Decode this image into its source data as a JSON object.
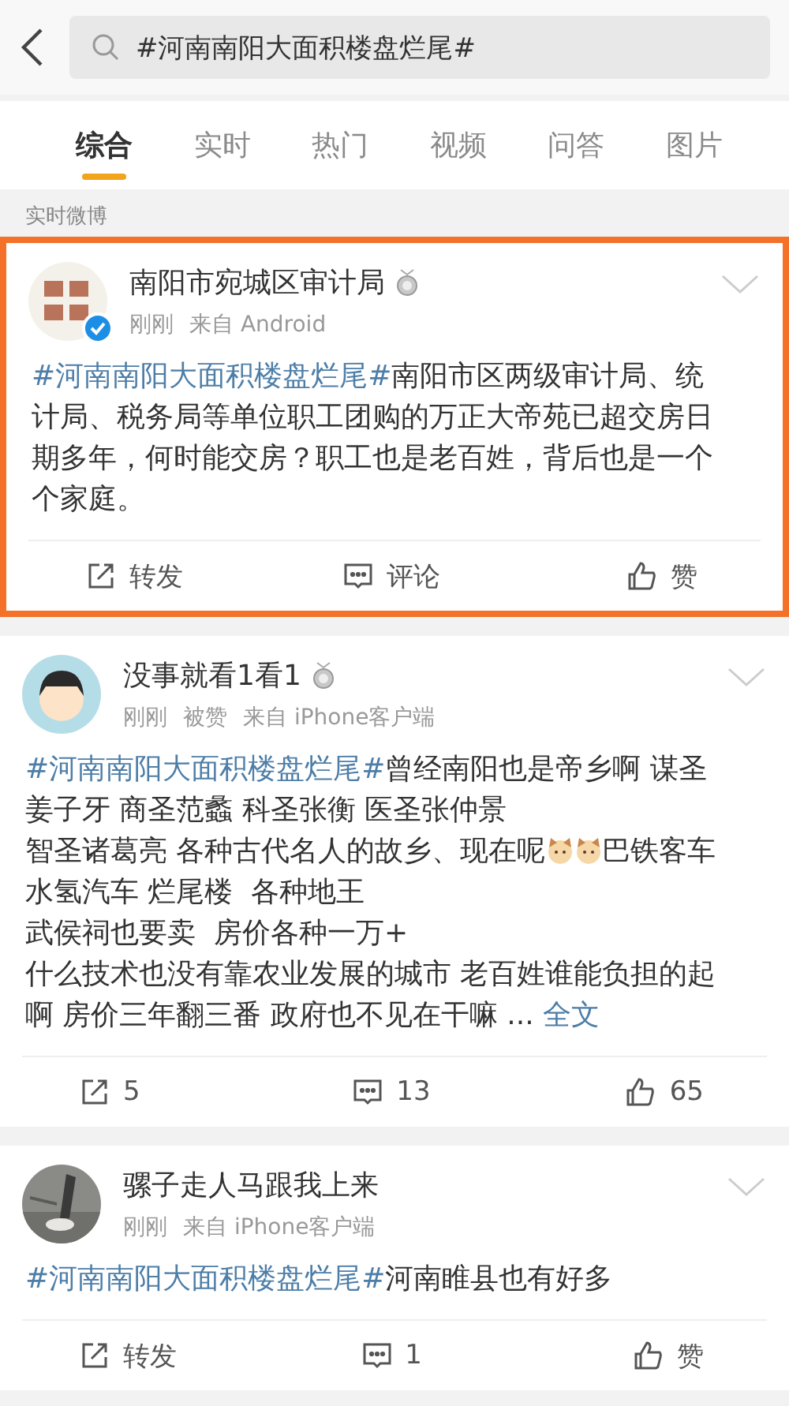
{
  "search": {
    "value": "#河南南阳大面积楼盘烂尾#"
  },
  "tabs": [
    {
      "label": "综合",
      "selected": true
    },
    {
      "label": "实时",
      "selected": false
    },
    {
      "label": "热门",
      "selected": false
    },
    {
      "label": "视频",
      "selected": false
    },
    {
      "label": "问答",
      "selected": false
    },
    {
      "label": "图片",
      "selected": false
    }
  ],
  "section_label": "实时微博",
  "posts": [
    {
      "highlighted": true,
      "verified": true,
      "medal": true,
      "avatar": {
        "kind": "picture"
      },
      "author": "南阳市宛城区审计局",
      "time": "刚刚",
      "meta": [
        "来自 Android"
      ],
      "body": [
        [
          {
            "kind": "hashtag",
            "text": "#河南南阳大面积楼盘烂尾#"
          },
          {
            "kind": "text",
            "text": "南阳市区两级审计局、统计局、税务局等单位职工团购的万正大帝苑已超交房日期多年，何时能交房？职工也是老百姓，背后也是一个个家庭。"
          }
        ]
      ],
      "actions": [
        {
          "kind": "repost",
          "label": "转发"
        },
        {
          "kind": "comment",
          "label": "评论"
        },
        {
          "kind": "like",
          "label": "赞"
        }
      ]
    },
    {
      "highlighted": false,
      "verified": false,
      "medal": true,
      "avatar": {
        "kind": "picture"
      },
      "author": "没事就看1看1",
      "time": "刚刚",
      "meta": [
        "被赞",
        "来自 iPhone客户端"
      ],
      "body": [
        [
          {
            "kind": "hashtag",
            "text": "#河南南阳大面积楼盘烂尾#"
          },
          {
            "kind": "text",
            "text": "曾经南阳也是帝乡啊 谋圣姜子牙 商圣范蠡 科圣张衡 医圣张仲景"
          }
        ],
        [
          {
            "kind": "text",
            "text": "智圣诸葛亮 各种古代名人的故乡、现在呢"
          },
          {
            "kind": "emoji"
          },
          {
            "kind": "emoji"
          },
          {
            "kind": "text",
            "text": "巴铁客车"
          }
        ],
        [
          {
            "kind": "text",
            "text": "水氢汽车 烂尾楼  各种地王"
          }
        ],
        [
          {
            "kind": "text",
            "text": "武侯祠也要卖  房价各种一万+"
          }
        ],
        [
          {
            "kind": "text",
            "text": "什么技术也没有靠农业发展的城市 老百姓谁能负担的起啊 房价三年翻三番 政府也不见在干嘛 ... "
          },
          {
            "kind": "link",
            "text": "全文"
          }
        ]
      ],
      "actions": [
        {
          "kind": "repost",
          "label": "5"
        },
        {
          "kind": "comment",
          "label": "13"
        },
        {
          "kind": "like",
          "label": "65"
        }
      ]
    },
    {
      "highlighted": false,
      "verified": false,
      "medal": false,
      "avatar": {
        "kind": "picture"
      },
      "author": "骡子走人马跟我上来",
      "time": "刚刚",
      "meta": [
        "来自 iPhone客户端"
      ],
      "body": [
        [
          {
            "kind": "hashtag",
            "text": "#河南南阳大面积楼盘烂尾#"
          },
          {
            "kind": "text",
            "text": "河南睢县也有好多"
          }
        ]
      ],
      "actions": [
        {
          "kind": "repost",
          "label": "转发"
        },
        {
          "kind": "comment",
          "label": "1"
        },
        {
          "kind": "like",
          "label": "赞"
        }
      ]
    }
  ]
}
